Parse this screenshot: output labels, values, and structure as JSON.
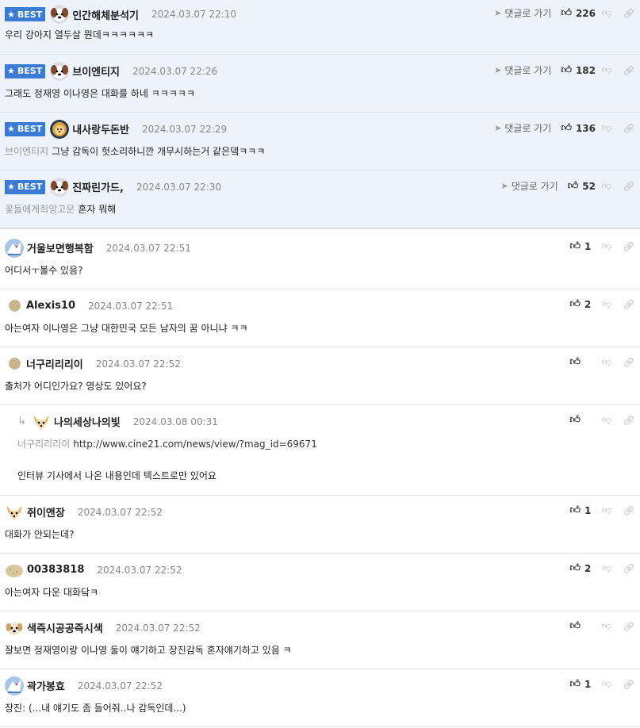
{
  "best_label": "BEST",
  "goto_label": "댓글로 가기",
  "comments": [
    {
      "nick": "인간해체분석기",
      "time": "2024.03.07 22:10",
      "text": "우리 강아지 열두살 뭔데ㅋㅋㅋㅋㅋㅋ",
      "likes": "226",
      "avatar": "dog-face"
    },
    {
      "nick": "브이엔티지",
      "time": "2024.03.07 22:26",
      "text": "그래도 정재영 이나영은 대화를 하네 ㅋㅋㅋㅋㅋ",
      "likes": "182",
      "avatar": "dog-face"
    },
    {
      "nick": "내사랑두돈반",
      "time": "2024.03.07 22:29",
      "mention": "브이엔티지",
      "text": "그냥 감독이 헛소리하니깐 개무시하는거 같은뎈ㅋㅋㅋ",
      "likes": "136",
      "avatar": "lion-face"
    },
    {
      "nick": "진짜린가드,",
      "time": "2024.03.07 22:30",
      "mention": "꽃들에게희망고문",
      "text": "혼자 뭐해",
      "likes": "52",
      "avatar": "dog-face"
    },
    {
      "nick": "거울보면행복함",
      "time": "2024.03.07 22:51",
      "text": "어디서ㅜ볼수 있음?",
      "likes": "1",
      "avatar": "blue-bird"
    },
    {
      "nick": "Alexis10",
      "time": "2024.03.07 22:51",
      "text": "아는여자 이나영은 그냥 대한민국 모든 남자의 꿈 아니냐 ㅋㅋ",
      "likes": "2",
      "avatar": "dot"
    },
    {
      "nick": "너구리리리이",
      "time": "2024.03.07 22:52",
      "text": "출처가 어디인가요? 영상도 있어요?",
      "likes": "",
      "avatar": "dot"
    },
    {
      "nick": "나의세상나의빛",
      "time": "2024.03.08 00:31",
      "mention": "너구리리리이",
      "text": "http://www.cine21.com/news/view/?mag_id=69671",
      "text2": "인터뷰 기사에서 나온 내용인데 텍스트로만 있어요",
      "likes": "",
      "avatar": "fox-face"
    },
    {
      "nick": "쥐이앤장",
      "time": "2024.03.07 22:52",
      "text": "대화가 안되는데?",
      "likes": "1",
      "avatar": "fox-face"
    },
    {
      "nick": "00383818",
      "time": "2024.03.07 22:52",
      "text": "아는여자 다운 대화닼ㅋ",
      "likes": "2",
      "avatar": "potato"
    },
    {
      "nick": "색즉시공공즉시색",
      "time": "2024.03.07 22:52",
      "text": "잘보면 정재영이랑 이나영 둘이 얘기하고 장진감독 혼자얘기하고 있음 ㅋ",
      "likes": "",
      "avatar": "puppy"
    },
    {
      "nick": "곽가봉효",
      "time": "2024.03.07 22:52",
      "text": "장진: (...내 얘기도 좀 들어줘..나 감독인데...)",
      "likes": "1",
      "avatar": "blue-bird"
    }
  ],
  "colors": {
    "best_bg": "#eef2fb",
    "badge": "#3a7bd5"
  }
}
